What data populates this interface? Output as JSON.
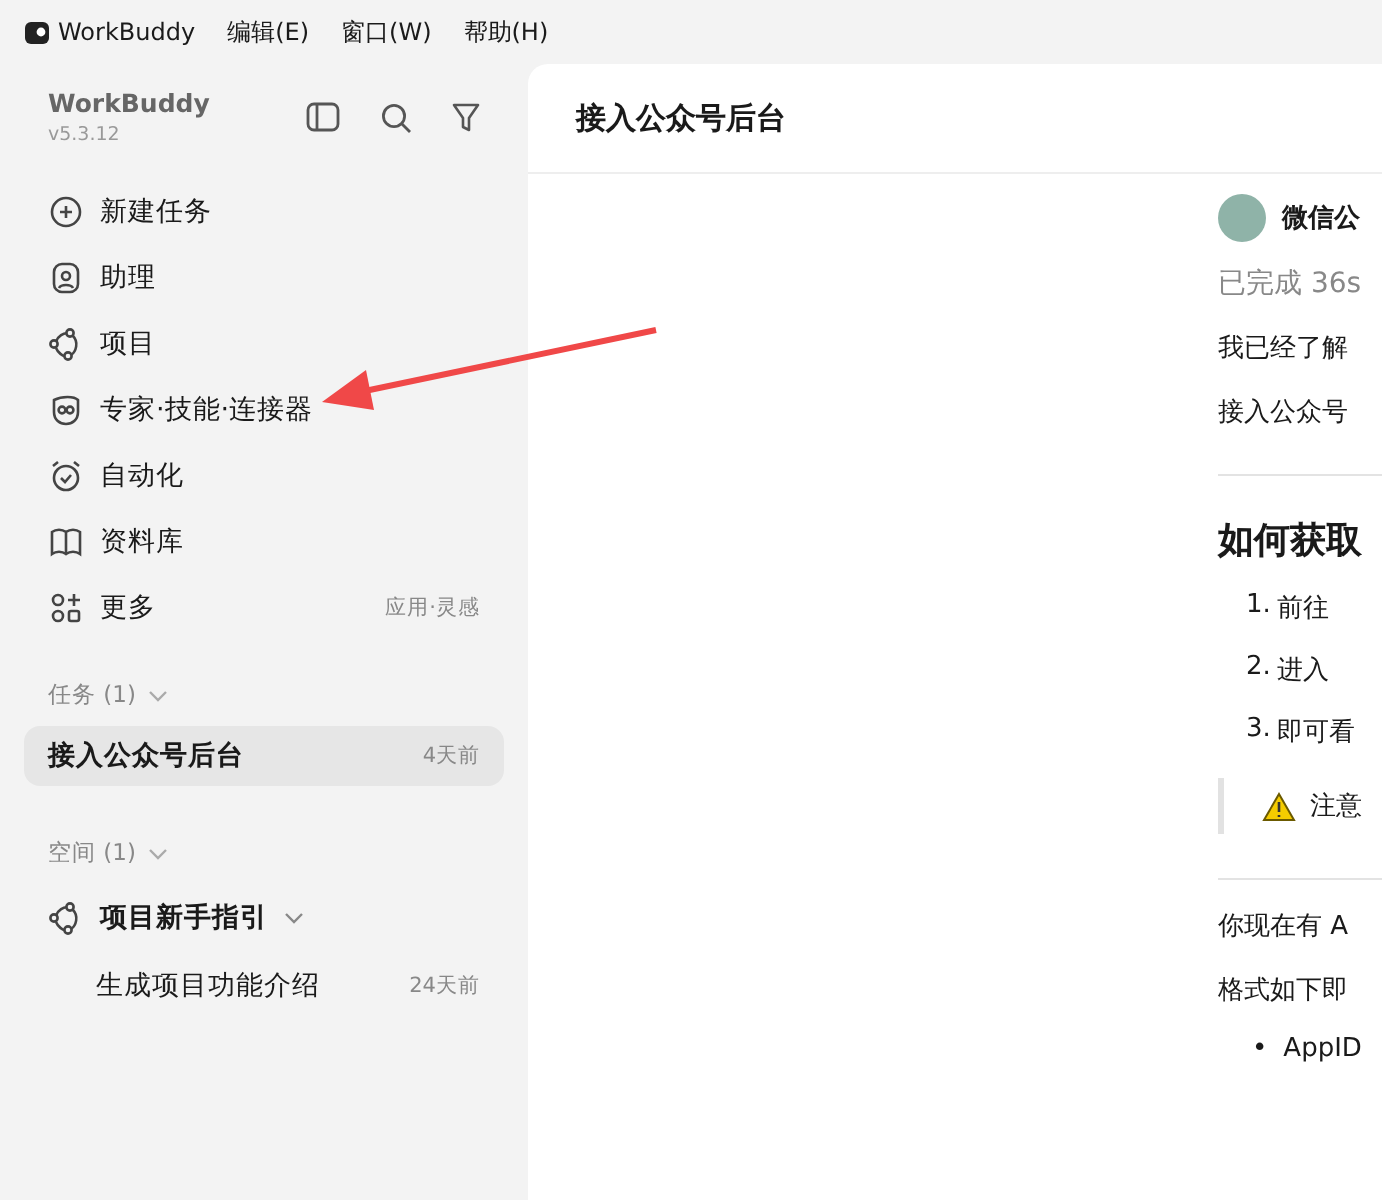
{
  "menu_bar": {
    "app_name": "WorkBuddy",
    "items": [
      "编辑(E)",
      "窗口(W)",
      "帮助(H)"
    ]
  },
  "sidebar": {
    "title": "WorkBuddy",
    "version": "v5.3.12",
    "nav": [
      {
        "kind": "plus",
        "label": "新建任务"
      },
      {
        "kind": "assistant",
        "label": "助理"
      },
      {
        "kind": "project",
        "label": "项目"
      },
      {
        "kind": "expert",
        "label": "专家·技能·连接器"
      },
      {
        "kind": "alarm",
        "label": "自动化"
      },
      {
        "kind": "book",
        "label": "资料库"
      },
      {
        "kind": "more",
        "label": "更多",
        "hint": "应用·灵感"
      }
    ],
    "tasks": {
      "heading": "任务 (1)",
      "items": [
        {
          "label": "接入公众号后台",
          "time": "4天前",
          "selected": true
        }
      ]
    },
    "spaces": {
      "heading": "空间 (1)",
      "project": "项目新手指引",
      "items": [
        {
          "label": "生成项目功能介绍",
          "time": "24天前",
          "selected": false
        }
      ]
    }
  },
  "main": {
    "title": "接入公众号后台",
    "message": {
      "sender": "微信公",
      "status": "已完成 36s",
      "blocks": [
        {
          "kind": "p",
          "text": "我已经了解"
        },
        {
          "kind": "p",
          "text": "接入公众号"
        },
        {
          "kind": "hr"
        },
        {
          "kind": "h",
          "text": "如何获取"
        },
        {
          "kind": "ol",
          "marker": "1.",
          "text": "前往"
        },
        {
          "kind": "ol",
          "marker": "2.",
          "text": "进入"
        },
        {
          "kind": "ol",
          "marker": "3.",
          "text": "即可看"
        },
        {
          "kind": "note",
          "text": "注意"
        },
        {
          "kind": "hr"
        },
        {
          "kind": "p",
          "text": "你现在有 A"
        },
        {
          "kind": "p",
          "text": "格式如下即"
        },
        {
          "kind": "ul",
          "marker": "•",
          "text": "AppID"
        }
      ]
    }
  }
}
